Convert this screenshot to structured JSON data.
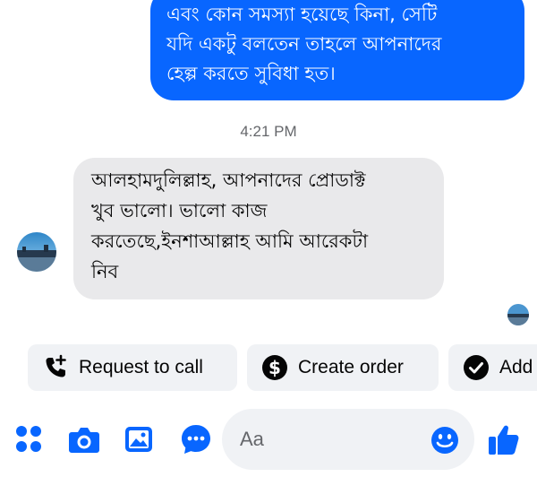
{
  "thread": {
    "outgoing_message": "এবং কোন সমস্যা হয়েছে কিনা, সেটি\nযদি একটু বলতেন তাহলে আপনাদের\nহেল্প করতে সুবিধা হত।",
    "timestamp": "4:21 PM",
    "incoming_message": "আলহামদুলিল্লাহ, আপনাদের প্রোডাক্ট\nখুব ভালো। ভালো কাজ\nকরতেছে,ইনশাআল্লাহ  আমি আরেকটা\nনিব"
  },
  "quick_actions": [
    {
      "label": "Request to call",
      "icon": "phone-plus-icon"
    },
    {
      "label": "Create order",
      "icon": "dollar-circle-icon"
    },
    {
      "label": "Add",
      "icon": "check-circle-icon"
    }
  ],
  "composer": {
    "placeholder": "Aa",
    "icons": [
      "grid-dots-icon",
      "camera-icon",
      "gallery-icon",
      "chat-bubble-icon",
      "emoji-icon",
      "thumbs-up-icon"
    ]
  },
  "colors": {
    "accent": "#0866ff",
    "outgoing_bubble": "#0866ff",
    "incoming_bubble": "#e9e9eb",
    "chip_background": "#f0f2f5",
    "muted_text": "#65676b"
  }
}
